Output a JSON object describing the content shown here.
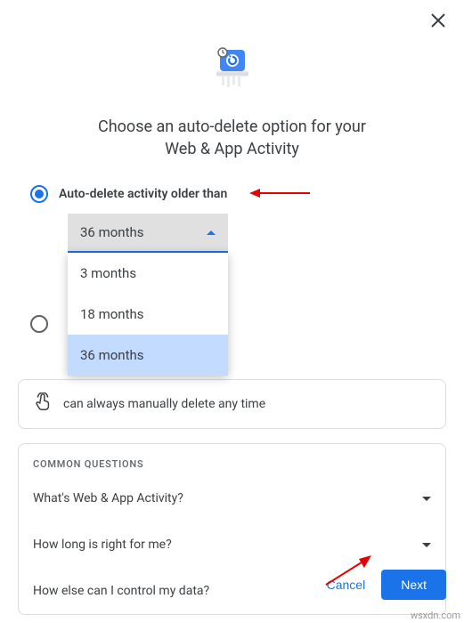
{
  "dialog": {
    "title_line1": "Choose an auto-delete option for your",
    "title_line2": "Web & App Activity"
  },
  "options": {
    "option1_label": "Auto-delete activity older than",
    "option1_selected": true,
    "option2_selected": false,
    "dropdown_value": "36 months",
    "dropdown_items": [
      "3 months",
      "18 months",
      "36 months"
    ],
    "dropdown_highlighted": "36 months"
  },
  "info": {
    "text": "can always manually delete any time"
  },
  "questions": {
    "header": "COMMON QUESTIONS",
    "items": [
      "What's Web & App Activity?",
      "How long is right for me?",
      "How else can I control my data?"
    ]
  },
  "footer": {
    "cancel": "Cancel",
    "next": "Next"
  },
  "watermark": "wsxdn.com"
}
